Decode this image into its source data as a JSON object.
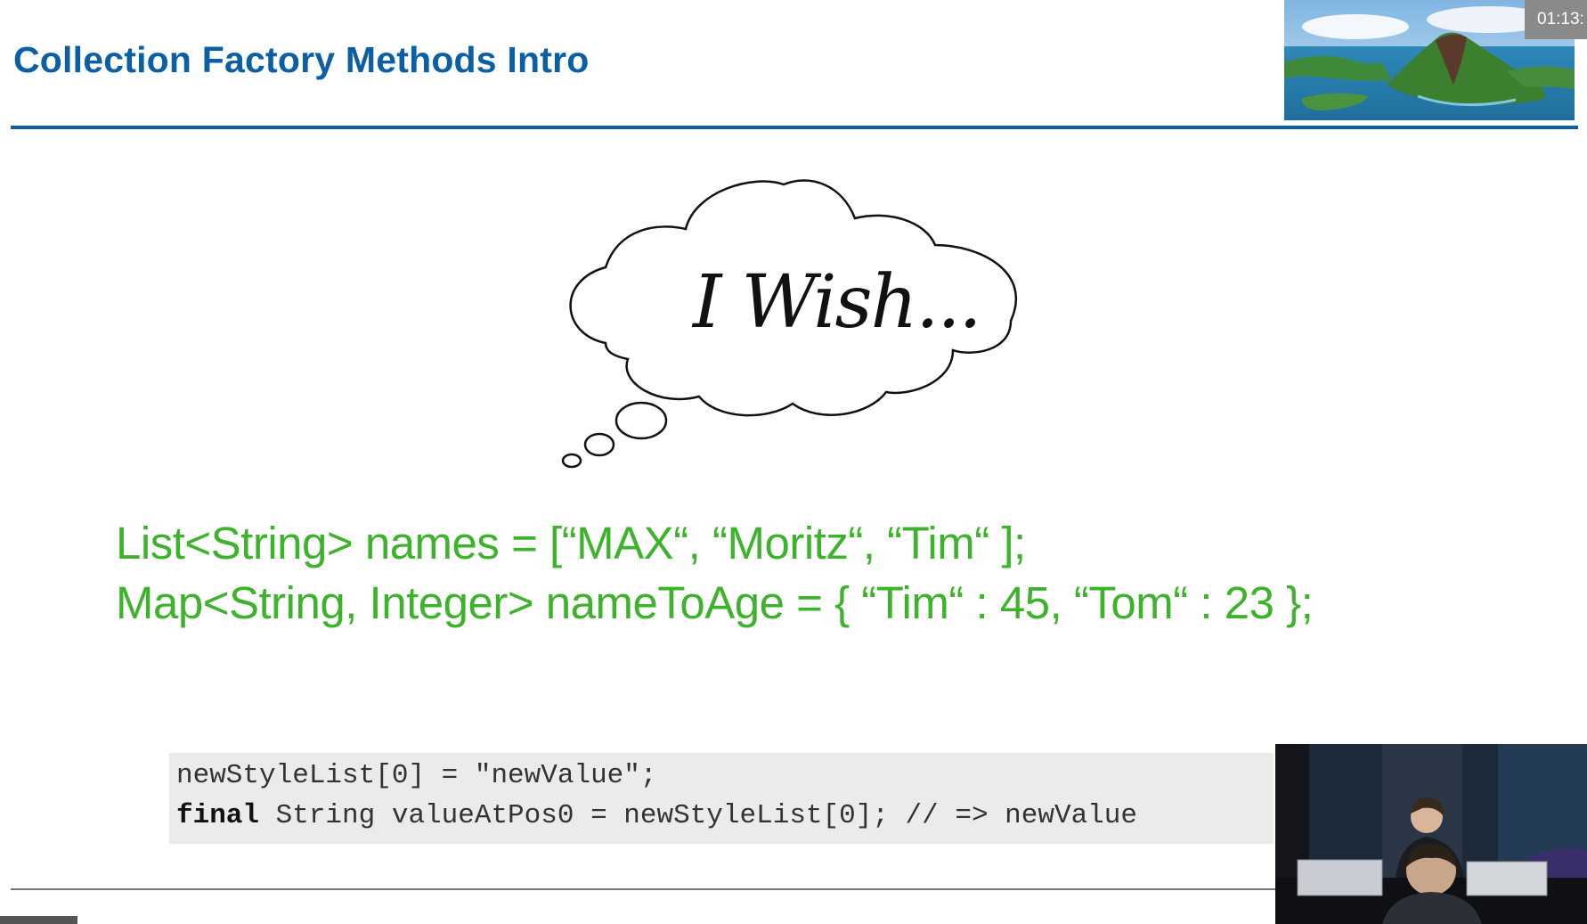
{
  "slide": {
    "title": "Collection Factory Methods Intro",
    "timer": "01:13:",
    "wish_text": "I Wish...",
    "code_lines": [
      "List<String> names = [“MAX“, “Moritz“, “Tim“ ];",
      "Map<String, Integer> nameToAge = { “Tim“ : 45, “Tom“ : 23 };"
    ],
    "snippet": {
      "line1": "newStyleList[0] = \"newValue\";",
      "line2_keyword": "final",
      "line2_rest": " String valueAtPos0 = newStyleList[0]; // => newValue"
    }
  },
  "colors": {
    "title": "#0b5fa5",
    "code_green": "#3db32c",
    "snippet_bg": "#ebebeb"
  },
  "icons": {
    "header_image": "island-photo",
    "thought_bubble": "cloud-shape",
    "webcam": "speaker-video"
  }
}
